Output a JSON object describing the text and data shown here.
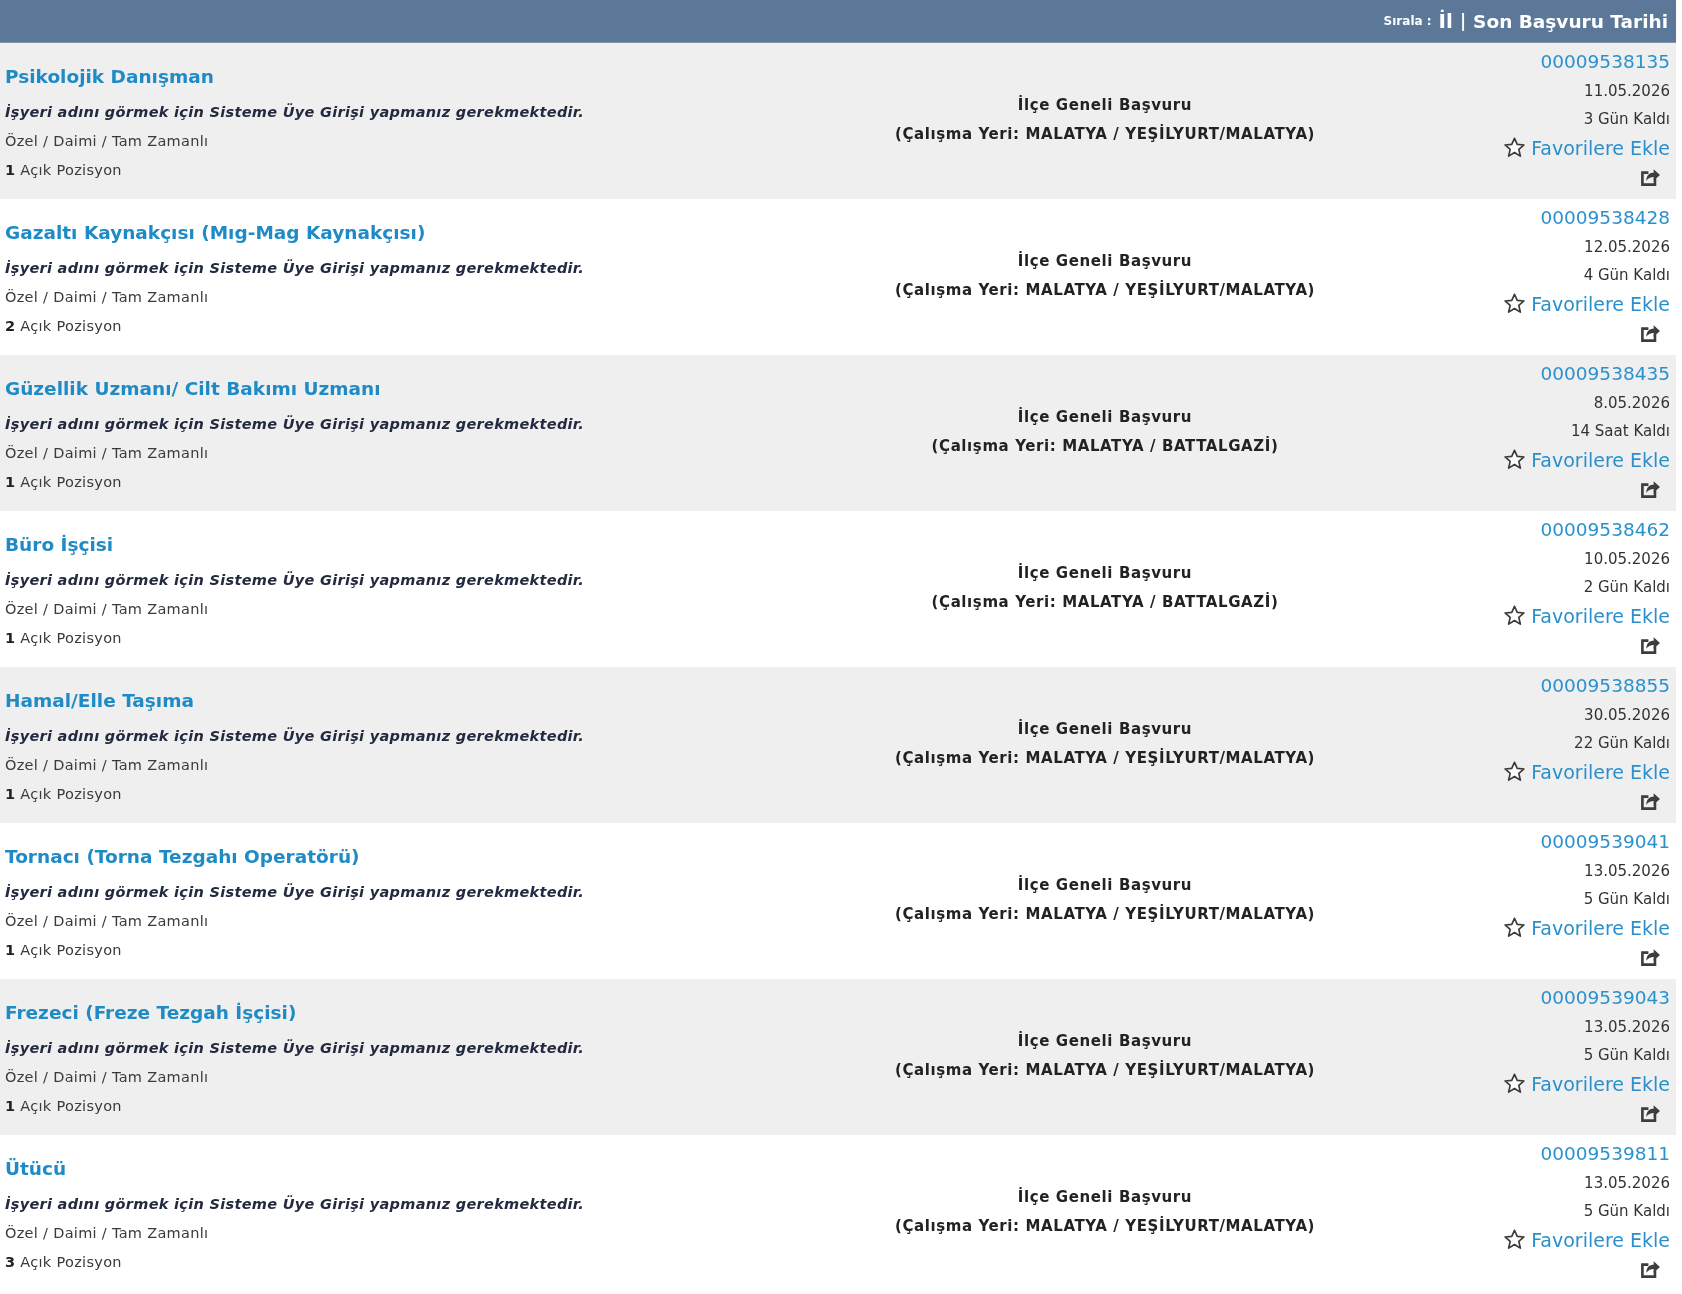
{
  "sort_bar": {
    "label": "Sırala :",
    "separator": "|",
    "options": [
      "İl",
      "Son Başvuru Tarihi"
    ]
  },
  "listings": [
    {
      "title": "Psikolojik Danışman",
      "employer_notice": "İşyeri adını görmek için Sisteme Üye Girişi yapmanız gerekmektedir.",
      "job_type": "Özel / Daimi / Tam Zamanlı",
      "positions": "**1** Açık Pozisyon",
      "application_scope": "İlçe Geneli Başvuru",
      "location": "(Çalışma Yeri: MALATYA / YEŞİLYURT/MALATYA)",
      "listing_number": "00009538135",
      "deadline": "11.05.2026",
      "remaining": "3 Gün Kaldı",
      "favorite_label": "Favorilere Ekle"
    },
    {
      "title": "Gazaltı Kaynakçısı (Mıg-Mag Kaynakçısı)",
      "employer_notice": "İşyeri adını görmek için Sisteme Üye Girişi yapmanız gerekmektedir.",
      "job_type": "Özel / Daimi / Tam Zamanlı",
      "positions": "**2** Açık Pozisyon",
      "application_scope": "İlçe Geneli Başvuru",
      "location": "(Çalışma Yeri: MALATYA / YEŞİLYURT/MALATYA)",
      "listing_number": "00009538428",
      "deadline": "12.05.2026",
      "remaining": "4 Gün Kaldı",
      "favorite_label": "Favorilere Ekle"
    },
    {
      "title": "Güzellik Uzmanı/ Cilt Bakımı Uzmanı",
      "employer_notice": "İşyeri adını görmek için Sisteme Üye Girişi yapmanız gerekmektedir.",
      "job_type": "Özel / Daimi / Tam Zamanlı",
      "positions": "**1** Açık Pozisyon",
      "application_scope": "İlçe Geneli Başvuru",
      "location": "(Çalışma Yeri: MALATYA / BATTALGAZİ)",
      "listing_number": "00009538435",
      "deadline": "8.05.2026",
      "remaining": "14 Saat Kaldı",
      "favorite_label": "Favorilere Ekle"
    },
    {
      "title": "Büro İşçisi",
      "employer_notice": "İşyeri adını görmek için Sisteme Üye Girişi yapmanız gerekmektedir.",
      "job_type": "Özel / Daimi / Tam Zamanlı",
      "positions": "**1** Açık Pozisyon",
      "application_scope": "İlçe Geneli Başvuru",
      "location": "(Çalışma Yeri: MALATYA / BATTALGAZİ)",
      "listing_number": "00009538462",
      "deadline": "10.05.2026",
      "remaining": "2 Gün Kaldı",
      "favorite_label": "Favorilere Ekle"
    },
    {
      "title": "Hamal/Elle Taşıma",
      "employer_notice": "İşyeri adını görmek için Sisteme Üye Girişi yapmanız gerekmektedir.",
      "job_type": "Özel / Daimi / Tam Zamanlı",
      "positions": "**1** Açık Pozisyon",
      "application_scope": "İlçe Geneli Başvuru",
      "location": "(Çalışma Yeri: MALATYA / YEŞİLYURT/MALATYA)",
      "listing_number": "00009538855",
      "deadline": "30.05.2026",
      "remaining": "22 Gün Kaldı",
      "favorite_label": "Favorilere Ekle"
    },
    {
      "title": "Tornacı (Torna Tezgahı Operatörü)",
      "employer_notice": "İşyeri adını görmek için Sisteme Üye Girişi yapmanız gerekmektedir.",
      "job_type": "Özel / Daimi / Tam Zamanlı",
      "positions": "**1** Açık Pozisyon",
      "application_scope": "İlçe Geneli Başvuru",
      "location": "(Çalışma Yeri: MALATYA / YEŞİLYURT/MALATYA)",
      "listing_number": "00009539041",
      "deadline": "13.05.2026",
      "remaining": "5 Gün Kaldı",
      "favorite_label": "Favorilere Ekle"
    },
    {
      "title": "Frezeci (Freze Tezgah İşçisi)",
      "employer_notice": "İşyeri adını görmek için Sisteme Üye Girişi yapmanız gerekmektedir.",
      "job_type": "Özel / Daimi / Tam Zamanlı",
      "positions": "**1** Açık Pozisyon",
      "application_scope": "İlçe Geneli Başvuru",
      "location": "(Çalışma Yeri: MALATYA / YEŞİLYURT/MALATYA)",
      "listing_number": "00009539043",
      "deadline": "13.05.2026",
      "remaining": "5 Gün Kaldı",
      "favorite_label": "Favorilere Ekle"
    },
    {
      "title": "Ütücü",
      "employer_notice": "İşyeri adını görmek için Sisteme Üye Girişi yapmanız gerekmektedir.",
      "job_type": "Özel / Daimi / Tam Zamanlı",
      "positions": "**3** Açık Pozisyon",
      "application_scope": "İlçe Geneli Başvuru",
      "location": "(Çalışma Yeri: MALATYA / YEŞİLYURT/MALATYA)",
      "listing_number": "00009539811",
      "deadline": "13.05.2026",
      "remaining": "5 Gün Kaldı",
      "favorite_label": "Favorilere Ekle"
    }
  ]
}
